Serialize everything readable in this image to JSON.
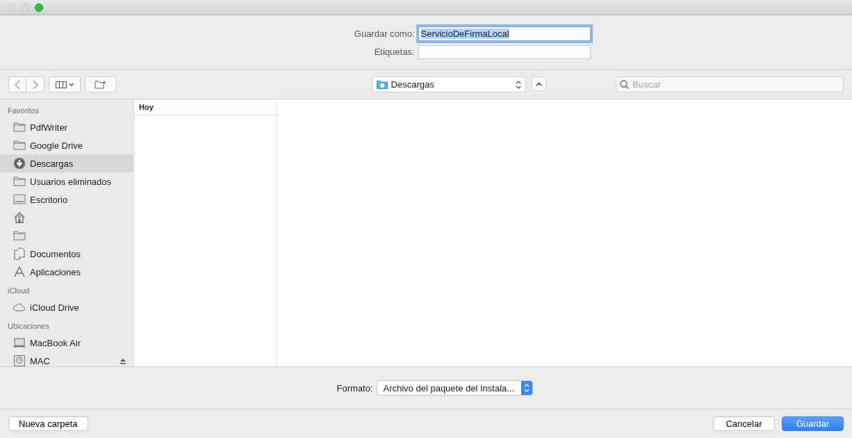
{
  "window": {
    "buttons": [
      {
        "kind": "close",
        "active": false
      },
      {
        "kind": "minimize",
        "active": false
      },
      {
        "kind": "zoom",
        "active": true
      }
    ]
  },
  "save_as": {
    "label": "Guardar como:",
    "value": "ServicioDeFirmaLocal",
    "selected": true
  },
  "tags": {
    "label": "Etiquetas:"
  },
  "toolbar": {
    "location": "Descargas",
    "search": {
      "placeholder": "Buscar"
    }
  },
  "sidebar": {
    "sections": [
      {
        "title": "Favoritos",
        "items": [
          {
            "kind": "folder",
            "label": "PdfWriter",
            "selected": false
          },
          {
            "kind": "folder",
            "label": "Google Drive",
            "selected": false
          },
          {
            "kind": "downloads",
            "label": "Descargas",
            "selected": true
          },
          {
            "kind": "folder",
            "label": "Usuarios eliminados",
            "selected": false
          },
          {
            "kind": "desktop",
            "label": "Escritorio",
            "selected": false
          },
          {
            "kind": "home",
            "selected": false
          },
          {
            "kind": "folder",
            "selected": false
          },
          {
            "kind": "documents",
            "label": "Documentos",
            "selected": false
          },
          {
            "kind": "apps",
            "label": "Aplicaciones",
            "selected": false
          }
        ]
      },
      {
        "title": "iCloud",
        "items": [
          {
            "kind": "cloud",
            "label": "iCloud Drive",
            "selected": false
          }
        ]
      },
      {
        "title": "Ubicaciones",
        "items": [
          {
            "kind": "laptop",
            "label": "MacBook Air",
            "selected": false
          },
          {
            "kind": "disk",
            "label": "MAC",
            "selected": false,
            "ejectable": true
          }
        ]
      }
    ]
  },
  "column": {
    "header": "Hoy"
  },
  "format": {
    "label": "Formato:",
    "value": "Archivo del paquete del Instala..."
  },
  "buttons": [
    {
      "kind": "secondary",
      "label": "Nueva carpeta"
    },
    {
      "kind": "secondary",
      "label": "Cancelar"
    },
    {
      "kind": "primary",
      "label": "Guardar"
    }
  ]
}
